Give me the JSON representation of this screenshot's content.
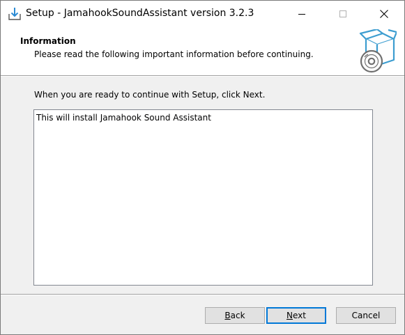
{
  "window": {
    "title": "Setup - JamahookSoundAssistant version 3.2.3",
    "icon": "installer-download-icon",
    "controls": {
      "minimize_icon": "minimize-icon",
      "maximize_icon": "maximize-icon",
      "close_icon": "close-icon"
    }
  },
  "header": {
    "title": "Information",
    "subtitle": "Please read the following important information before continuing.",
    "image_icon": "box-with-cd-icon"
  },
  "body": {
    "instruction": "When you are ready to continue with Setup, click Next.",
    "info_text": "This will install Jamahook Sound Assistant"
  },
  "buttons": {
    "back": {
      "mnemonic": "B",
      "rest": "ack"
    },
    "next": {
      "mnemonic": "N",
      "rest": "ext"
    },
    "cancel": "Cancel"
  },
  "colors": {
    "accent": "#0078d7",
    "icon_blue": "#3c9dd0",
    "face": "#f0f0f0"
  }
}
